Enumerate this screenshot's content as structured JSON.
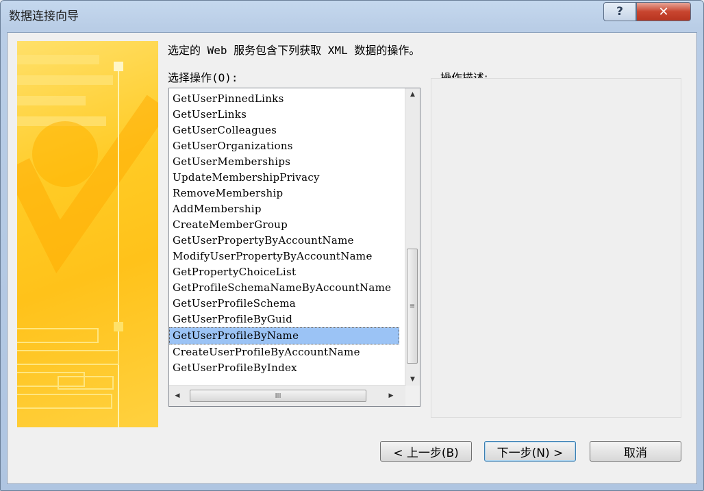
{
  "window": {
    "title": "数据连接向导"
  },
  "titlebar": {
    "help_label": "?",
    "close_label": "✕"
  },
  "wizard": {
    "heading": "选定的 Web 服务包含下列获取 XML 数据的操作。",
    "operations_label": "选择操作(O):",
    "description_label": "操作描述:",
    "operations": [
      "GetUserPinnedLinks",
      "GetUserLinks",
      "GetUserColleagues",
      "GetUserOrganizations",
      "GetUserMemberships",
      "UpdateMembershipPrivacy",
      "RemoveMembership",
      "AddMembership",
      "CreateMemberGroup",
      "GetUserPropertyByAccountName",
      "ModifyUserPropertyByAccountName",
      "GetPropertyChoiceList",
      "GetProfileSchemaNameByAccountName",
      "GetUserProfileSchema",
      "GetUserProfileByGuid",
      "GetUserProfileByName",
      "CreateUserProfileByAccountName",
      "GetUserProfileByIndex"
    ],
    "selected_operation": "GetUserProfileByName",
    "scrollbar_grip": "≡",
    "hscroll_grip": "III"
  },
  "buttons": {
    "back": "< 上一步(B)",
    "next": "下一步(N) >",
    "cancel": "取消"
  },
  "colors": {
    "banner": "#ffc21a",
    "selection": "#9bc3f5",
    "close": "#c8452f"
  }
}
